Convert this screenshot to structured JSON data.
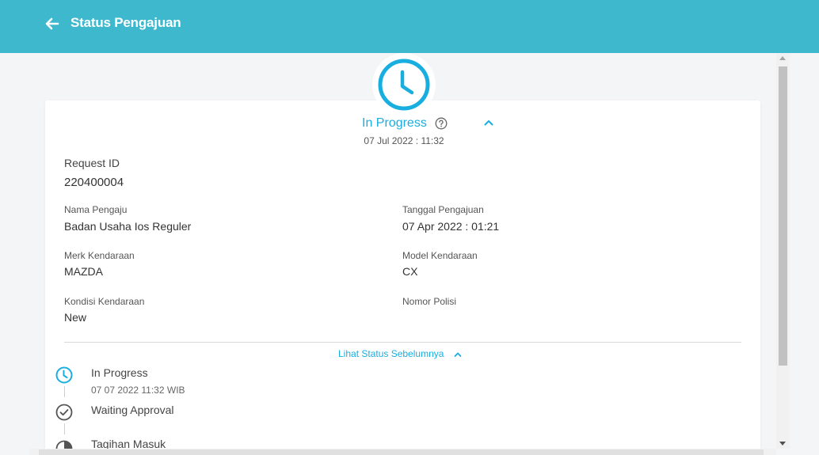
{
  "header": {
    "title": "Status Pengajuan",
    "back_icon": "arrow-left-icon",
    "background": "#3db8cd"
  },
  "status": {
    "title": "In Progress",
    "date": "07 Jul 2022 : 11:32",
    "accent": "#19aee0"
  },
  "request": {
    "id_label": "Request ID",
    "id_value": "220400004"
  },
  "fields": {
    "nama_pengaju_label": "Nama Pengaju",
    "nama_pengaju_value": "Badan Usaha Ios Reguler",
    "tanggal_label": "Tanggal Pengajuan",
    "tanggal_value": "07 Apr 2022 : 01:21",
    "merk_label": "Merk Kendaraan",
    "merk_value": "MAZDA",
    "model_label": "Model Kendaraan",
    "model_value": "CX",
    "kondisi_label": "Kondisi Kendaraan",
    "kondisi_value": "New",
    "polisi_label": "Nomor Polisi",
    "polisi_value": ""
  },
  "history": {
    "toggle_label": "Lihat Status Sebelumnya",
    "items": [
      {
        "title": "In Progress",
        "subtitle": "07 07 2022 11:32 WIB",
        "icon": "clock-icon"
      },
      {
        "title": "Waiting Approval",
        "subtitle": "",
        "icon": "check-circle-icon"
      },
      {
        "title": "Tagihan Masuk",
        "subtitle": "",
        "icon": "half-circle-icon"
      }
    ]
  }
}
